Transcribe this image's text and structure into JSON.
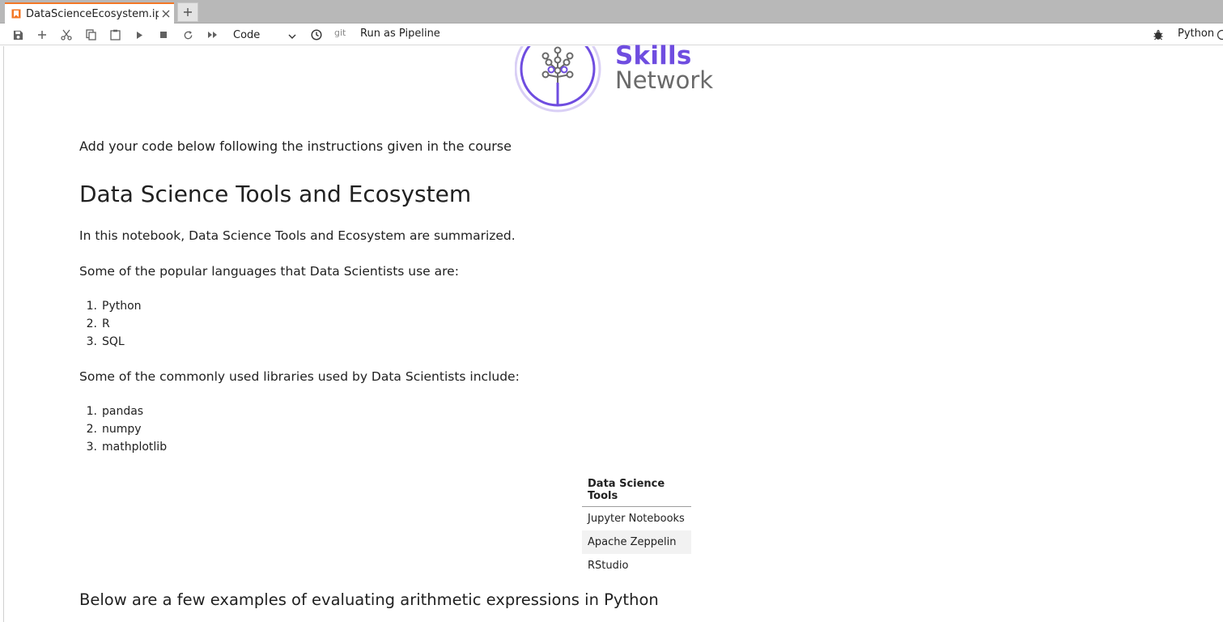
{
  "tab": {
    "title": "DataScienceEcosystem.ipyn"
  },
  "toolbar": {
    "cell_type": "Code",
    "git_label": "git",
    "pipeline_label": "Run as Pipeline",
    "kernel_name": "Python"
  },
  "logo": {
    "line1": "Skills",
    "line2": "Network"
  },
  "notebook": {
    "instruction": "Add your code below following the instructions given in the course",
    "title": "Data Science Tools and Ecosystem",
    "intro": "In this notebook, Data Science Tools and Ecosystem are summarized.",
    "languages_heading": "Some of the popular languages that Data Scientists use are:",
    "languages": [
      "Python",
      "R",
      "SQL"
    ],
    "libraries_heading": "Some of the commonly used libraries used by Data Scientists include:",
    "libraries": [
      "pandas",
      "numpy",
      "mathplotlib"
    ],
    "tools_table": {
      "header": "Data Science Tools",
      "rows": [
        "Jupyter Notebooks",
        "Apache Zeppelin",
        "RStudio"
      ]
    },
    "arith_heading": "Below are a few examples of evaluating arithmetic expressions in Python"
  },
  "colors": {
    "tab_accent": "#f37726",
    "logo_purple": "#6f4de0",
    "logo_gray": "#6a6a6a"
  }
}
